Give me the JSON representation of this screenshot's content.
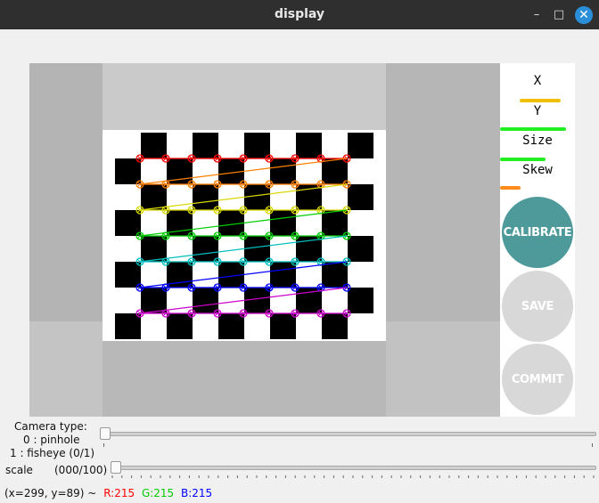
{
  "window": {
    "title": "display"
  },
  "panel": {
    "x_label": "X",
    "y_label": "Y",
    "size_label": "Size",
    "skew_label": "Skew",
    "x_bar_color": "#f0c000",
    "y_bar_color": "#22ee22",
    "size_bar_color": "#22ee22",
    "skew_bar_color": "#ff8c1a",
    "x_level": 0.55,
    "y_level": 0.95,
    "size_level": 0.65,
    "skew_level": 0.3,
    "calibrate_label": "CALIBRATE",
    "calibrate_color": "#4e9a9a",
    "save_label": "SAVE",
    "commit_label": "COMMIT",
    "disabled_color": "#d8d8d8"
  },
  "trackbars": {
    "camera_type_line1": "Camera type:",
    "camera_type_line2": "0 : pinhole",
    "camera_type_line3": "1 : fisheye (0/1)",
    "camera_type_value": 0,
    "scale_label": "scale",
    "scale_value_text": "(000/100)",
    "scale_value": 0
  },
  "status": {
    "coords": "(x=299, y=89) ~",
    "r": "R:215",
    "g": "G:215",
    "b": "B:215",
    "r_color": "#ff0000",
    "g_color": "#00cc00",
    "b_color": "#0000ff"
  },
  "corner_row_colors": [
    "#ff0000",
    "#ff7f00",
    "#d8d800",
    "#00cc00",
    "#00bfbf",
    "#0000ff",
    "#cc00cc"
  ]
}
